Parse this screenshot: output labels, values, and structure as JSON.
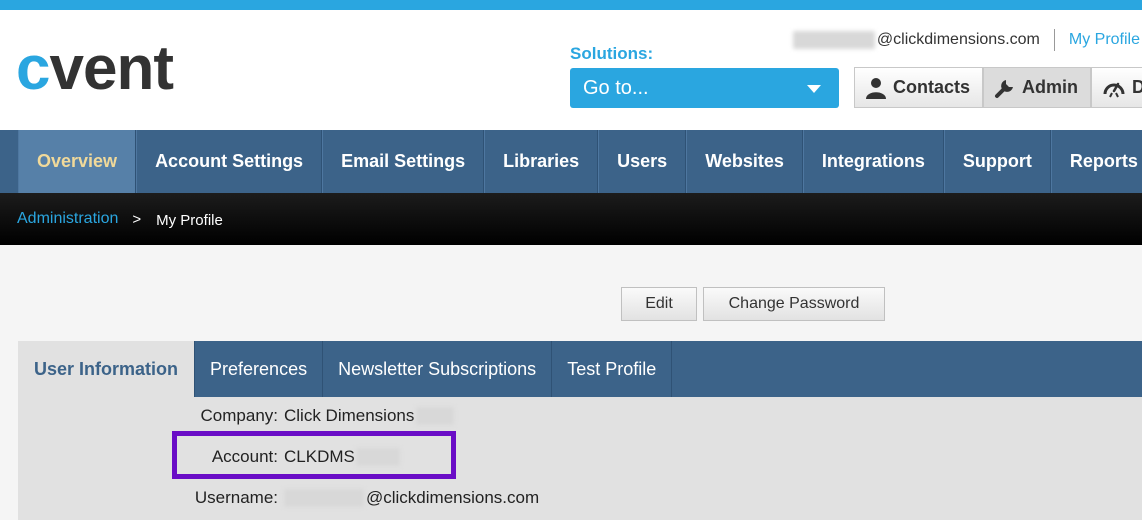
{
  "brand": {
    "logo_c": "c",
    "logo_rest": "vent"
  },
  "header": {
    "email_domain": "@clickdimensions.com",
    "my_profile_link": "My Profile",
    "solutions_label": "Solutions:",
    "goto_label": "Go to...",
    "apps": [
      {
        "label": "Contacts",
        "icon": "person-icon"
      },
      {
        "label": "Admin",
        "icon": "wrench-icon"
      },
      {
        "label": "D",
        "icon": "dashboard-icon"
      }
    ]
  },
  "nav": {
    "items": [
      "Overview",
      "Account Settings",
      "Email Settings",
      "Libraries",
      "Users",
      "Websites",
      "Integrations",
      "Support",
      "Reports"
    ],
    "active": "Overview"
  },
  "breadcrumb": {
    "root": "Administration",
    "separator": ">",
    "current": "My Profile"
  },
  "actions": {
    "edit": "Edit",
    "change_password": "Change Password"
  },
  "tabs": {
    "items": [
      "User Information",
      "Preferences",
      "Newsletter Subscriptions",
      "Test Profile"
    ],
    "active": "User Information"
  },
  "profile": {
    "company_label": "Company:",
    "company_value": "Click Dimensions",
    "account_label": "Account:",
    "account_value": "CLKDMS",
    "username_label": "Username:",
    "username_domain": "@clickdimensions.com"
  },
  "colors": {
    "accent": "#2aa6e0",
    "nav": "#3c6389",
    "nav_active": "#5680a8",
    "highlight": "#6a0dc6"
  }
}
